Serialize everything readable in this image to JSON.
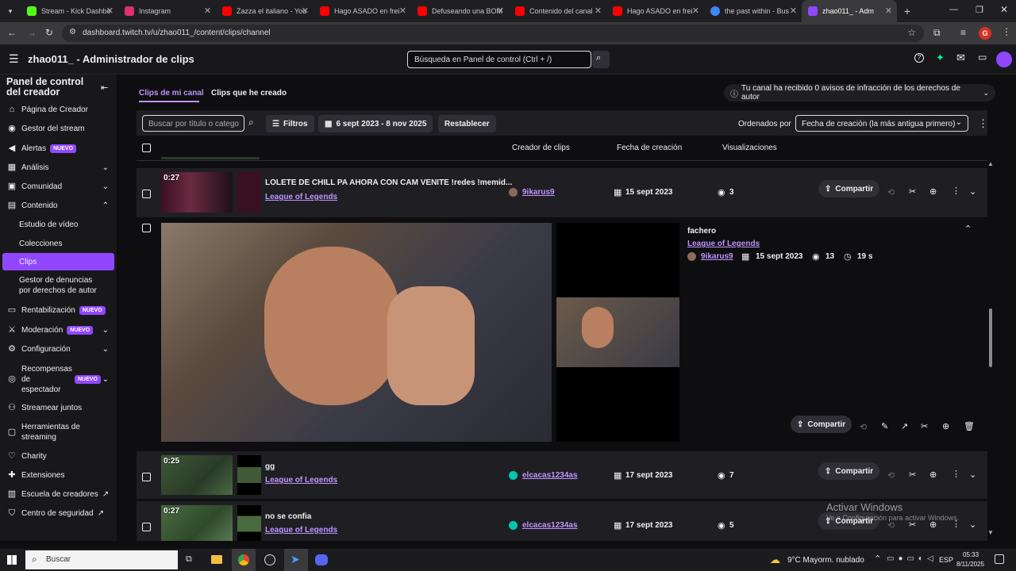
{
  "browser": {
    "tabs": [
      {
        "title": "Stream - Kick Dashbo",
        "color": "#53fc18"
      },
      {
        "title": "Instagram",
        "color": "#e1306c"
      },
      {
        "title": "Zazza el italiano - You",
        "color": "#ff0000"
      },
      {
        "title": "Hago ASADO en frei",
        "color": "#ff0000"
      },
      {
        "title": "Defuseando una BOM",
        "color": "#ff0000"
      },
      {
        "title": "Contenido del canal",
        "color": "#ff0000"
      },
      {
        "title": "Hago ASADO en frei",
        "color": "#ff0000"
      },
      {
        "title": "the past within - Bus",
        "color": "#4285f4"
      },
      {
        "title": "zhao011_ - Adm",
        "color": "#9147ff"
      }
    ],
    "url": "dashboard.twitch.tv/u/zhao011_/content/clips/channel",
    "profile_initial": "G"
  },
  "header": {
    "page_title": "zhao011_ - Administrador de clips",
    "search_placeholder": "Búsqueda en Panel de control (Ctrl + /)"
  },
  "sidebar": {
    "title": "Panel de control del creador",
    "items": [
      {
        "label": "Página de Creador",
        "icon": "home-icon"
      },
      {
        "label": "Gestor del stream",
        "icon": "stream-icon"
      },
      {
        "label": "Alertas",
        "icon": "alert-icon",
        "badge": "NUEVO"
      },
      {
        "label": "Análisis",
        "icon": "chart-icon"
      },
      {
        "label": "Comunidad",
        "icon": "community-icon"
      },
      {
        "label": "Contenido",
        "icon": "content-icon"
      },
      {
        "label": "Estudio de vídeo"
      },
      {
        "label": "Colecciones"
      },
      {
        "label": "Clips"
      },
      {
        "label": "Gestor de denuncias por derechos de autor"
      },
      {
        "label": "Rentabilización",
        "icon": "money-icon",
        "badge": "NUEVO"
      },
      {
        "label": "Moderación",
        "icon": "sword-icon",
        "badge": "NUEVO"
      },
      {
        "label": "Configuración",
        "icon": "gear-icon"
      },
      {
        "label": "Recompensas de espectador",
        "icon": "reward-icon",
        "badge": "NUEVO"
      },
      {
        "label": "Streamear juntos",
        "icon": "people-icon"
      },
      {
        "label": "Herramientas de streaming",
        "icon": "tools-icon"
      },
      {
        "label": "Charity",
        "icon": "charity-icon"
      },
      {
        "label": "Extensiones",
        "icon": "extension-icon"
      },
      {
        "label": "Escuela de creadores",
        "icon": "school-icon"
      },
      {
        "label": "Centro de seguridad",
        "icon": "shield-icon"
      }
    ]
  },
  "tabs": {
    "mine": "Clips de mi canal",
    "created": "Clips que he creado"
  },
  "copyright_notice": "Tu canal ha recibido 0 avisos de infracción de los derechos de autor",
  "filters": {
    "search_placeholder": "Buscar por título o catego",
    "filters_label": "Filtros",
    "date_range": "6 sept 2023 - 8 nov 2025",
    "reset_label": "Restablecer",
    "sort_label": "Ordenados por",
    "sort_value": "Fecha de creación (la más antigua primero)"
  },
  "table_headers": {
    "creator": "Creador de clips",
    "date": "Fecha de creación",
    "views": "Visualizaciones"
  },
  "clips": [
    {
      "duration": "0:27",
      "title": "LOLETE DE CHILL PA AHORA CON CAM VENITE !redes !memid...",
      "game": "League of Legends",
      "creator": "9ikarus9",
      "date": "15 sept 2023",
      "views": "3"
    },
    {
      "duration": "0:25",
      "title": "gg",
      "game": "League of Legends",
      "creator": "elcacas1234as",
      "date": "17 sept 2023",
      "views": "7"
    },
    {
      "duration": "0:27",
      "title": "no se confia",
      "game": "League of Legends",
      "creator": "elcacas1234as",
      "date": "17 sept 2023",
      "views": "5"
    }
  ],
  "expanded_clip": {
    "title": "fachero",
    "game": "League of Legends",
    "creator": "9ikarus9",
    "date": "15 sept 2023",
    "views": "13",
    "length": "19 s"
  },
  "share_label": "Compartir",
  "watermark": {
    "line1": "Activar Windows",
    "line2": "Ve a Configuración para activar Windows."
  },
  "taskbar": {
    "search_placeholder": "Buscar",
    "weather": "9°C  Mayorm. nublado",
    "lang": "ESP",
    "time": "05:33",
    "date": "8/11/2025"
  },
  "colors": {
    "accent": "#9147ff",
    "link": "#bf94ff",
    "bg": "#0e0e10",
    "row": "#1f1f23"
  }
}
